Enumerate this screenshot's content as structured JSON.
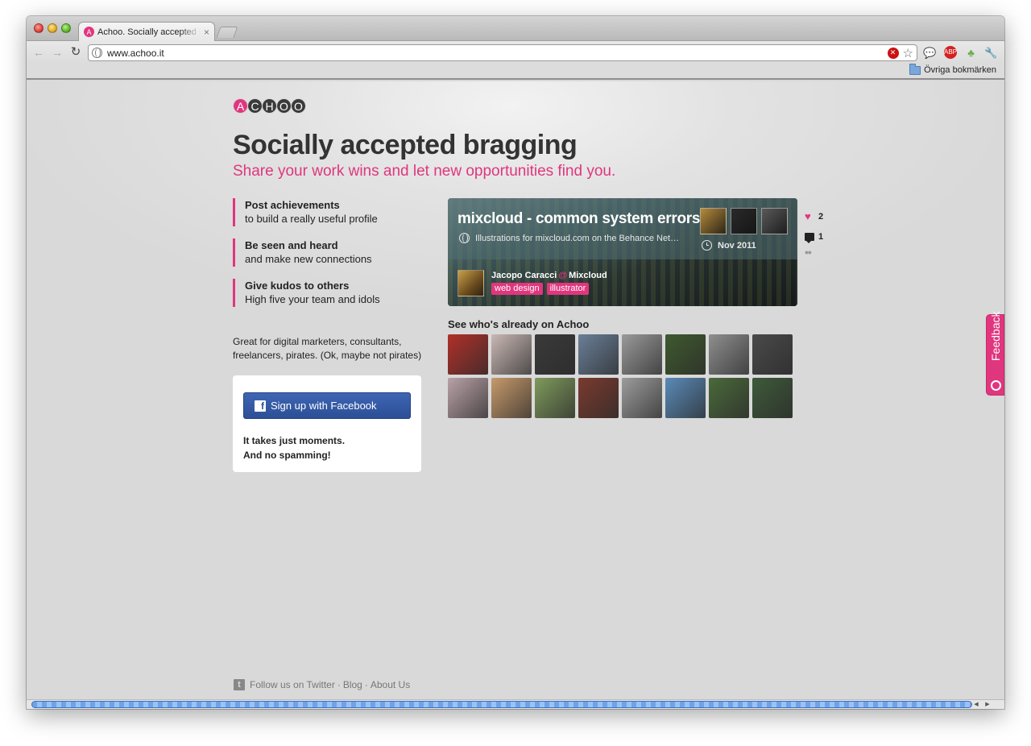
{
  "browser": {
    "tab_title": "Achoo. Socially accepted bragging",
    "tab_favicon_letter": "A",
    "tab_close": "×",
    "url": "www.achoo.it",
    "bookmark_folder": "Övriga bokmärken",
    "nav": {
      "back": "←",
      "forward": "→",
      "reload": "↻"
    }
  },
  "logo_letters": [
    "A",
    "C",
    "H",
    "O",
    "O"
  ],
  "hero": {
    "headline": "Socially accepted bragging",
    "subheadline": "Share your work wins and let new opportunities find you."
  },
  "features": [
    {
      "title": "Post achievements",
      "desc": "to build a really useful profile"
    },
    {
      "title": "Be seen and heard",
      "desc": "and make new connections"
    },
    {
      "title": "Give kudos to others",
      "desc": "High five your team and idols"
    }
  ],
  "blurb": "Great for digital marketers, consultants, freelancers, pirates. (Ok, maybe not pirates)",
  "signup": {
    "facebook_label": "Sign up with Facebook",
    "facebook_icon": "f",
    "note_line1": "It takes just moments.",
    "note_line2": "And no spamming!"
  },
  "card": {
    "title": "mixcloud - common system errors",
    "link_text": "Illustrations for mixcloud.com on the Behance Net…",
    "date": "Nov 2011",
    "author": "Jacopo Caracci",
    "at": "@",
    "company": "Mixcloud",
    "tags": [
      "web design",
      "illustrator"
    ],
    "likes": "2",
    "comments": "1",
    "more": "••",
    "avatar_colors": [
      "#b58a3a",
      "#2a2a2a",
      "#5a5a5a"
    ]
  },
  "people": {
    "heading": "See who's already on Achoo",
    "avatar_colors": [
      "#b0302a",
      "#c9b8b4",
      "#3a3a3a",
      "#6a7f97",
      "#9a9a9a",
      "#3f5a2e",
      "#8f8f8f",
      "#4a4a4a",
      "#b9a2a8",
      "#c79a6b",
      "#7f9a5c",
      "#7a3a2e",
      "#9c9c9c",
      "#5a8ab8",
      "#4a6a3a",
      "#3e5a3a"
    ]
  },
  "footer": {
    "twitter_icon": "t",
    "twitter": "Follow us on Twitter",
    "sep": "·",
    "blog": "Blog",
    "about": "About Us"
  },
  "feedback_label": "Feedback",
  "colors": {
    "brand_pink": "#e0367e",
    "facebook_blue": "#2c4f96",
    "text_dark": "#333333"
  }
}
